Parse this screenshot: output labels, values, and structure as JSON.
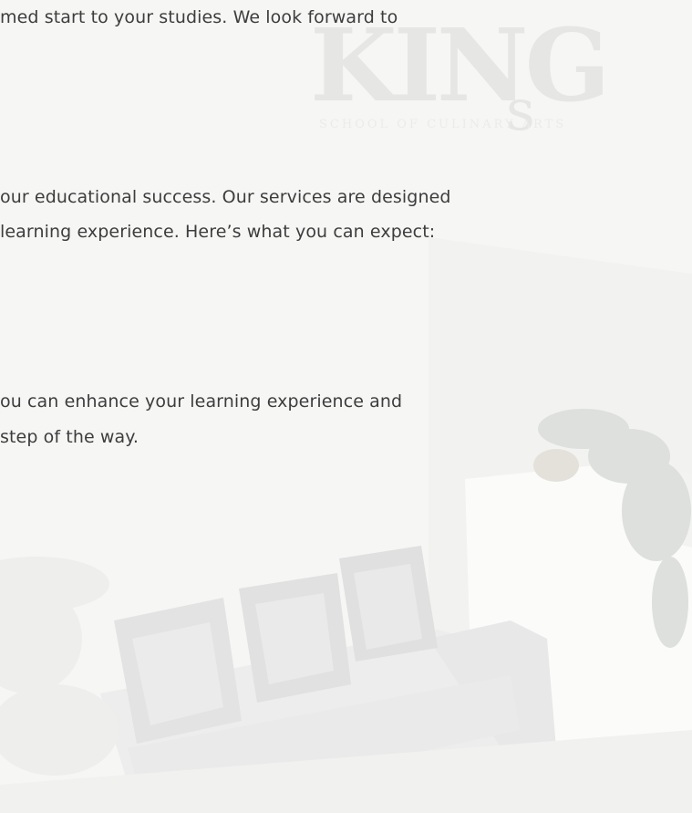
{
  "body_text": {
    "line1": "med start to your studies. We look forward to",
    "line2": "our educational success. Our services are designed",
    "line3": "learning experience. Here’s what you can expect:",
    "line4": "ou can enhance your learning experience and",
    "line5": "step of the way."
  },
  "logo": {
    "name": "KING's",
    "tagline": "SCHOOL OF CULINARY ARTS"
  },
  "colors": {
    "background": "#f7f7f6",
    "text": "#3d3d3d",
    "watermark": "#e6e6e4"
  }
}
